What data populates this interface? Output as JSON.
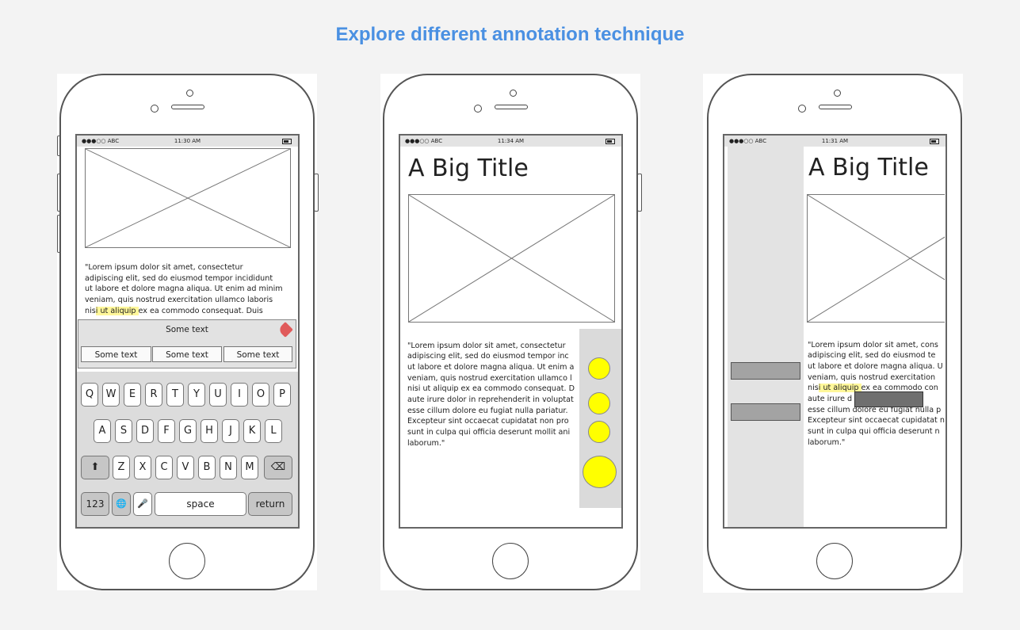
{
  "page": {
    "title": "Explore different annotation technique"
  },
  "phone1": {
    "carrier": "●●●○○ ABC",
    "time": "11:30 AM",
    "paragraph_lines": [
      "\"Lorem ipsum dolor sit amet, consectetur",
      "adipiscing elit, sed do eiusmod tempor incididunt",
      "ut labore et dolore magna aliqua. Ut enim ad minim",
      "veniam, quis nostrud exercitation ullamco laboris"
    ],
    "highlight_line": {
      "before": "nis",
      "highlight": "i ut aliquip ",
      "after": "ex ea commodo consequat. Duis"
    },
    "annotation_title": "Some text",
    "annotation_buttons": [
      "Some text",
      "Some text",
      "Some text"
    ],
    "tag_icon": "tag-icon",
    "tag_color": "#e05a5a",
    "keyboard": {
      "row1": [
        "Q",
        "W",
        "E",
        "R",
        "T",
        "Y",
        "U",
        "I",
        "O",
        "P"
      ],
      "row2": [
        "A",
        "S",
        "D",
        "F",
        "G",
        "H",
        "J",
        "K",
        "L"
      ],
      "row3": [
        "Z",
        "X",
        "C",
        "V",
        "B",
        "N",
        "M"
      ],
      "shift": "⬆",
      "backspace": "⌫",
      "numbers": "123",
      "globe": "🌐",
      "mic": "🎤",
      "space": "space",
      "return": "return"
    }
  },
  "phone2": {
    "carrier": "●●●○○ ABC",
    "time": "11:34 AM",
    "big_title": "A Big Title",
    "paragraph_lines": [
      "\"Lorem ipsum dolor sit amet, consectetur",
      "adipiscing elit, sed do eiusmod tempor inc",
      "ut labore et dolore magna aliqua. Ut enim a",
      "veniam, quis nostrud exercitation ullamco l",
      "nisi ut aliquip ex ea commodo consequat. D",
      "aute irure dolor in reprehenderit in voluptat",
      "esse cillum dolore eu fugiat nulla pariatur.",
      "Excepteur sint occaecat cupidatat non pro",
      "sunt in culpa qui officia deserunt mollit ani",
      "laborum.\""
    ],
    "marker_color": "#ffff00"
  },
  "phone3": {
    "carrier": "●●●○○ ABC",
    "time": "11:31 AM",
    "big_title": "A Big Title",
    "paragraph_lines": [
      "\"Lorem ipsum dolor sit amet, cons",
      "adipiscing elit, sed do eiusmod te",
      "ut labore et dolore magna aliqua. U",
      "veniam, quis nostrud exercitation "
    ],
    "highlight_line": {
      "before": "nis",
      "highlight": "i ut aliquip ",
      "after": "ex ea commodo con"
    },
    "paragraph_lines_2": [
      "aute irure d            erit in",
      "esse cillum dolore eu fugiat nulla p",
      "Excepteur sint occaecat cupidatat n",
      "sunt in culpa qui officia deserunt n",
      "laborum.\""
    ]
  }
}
